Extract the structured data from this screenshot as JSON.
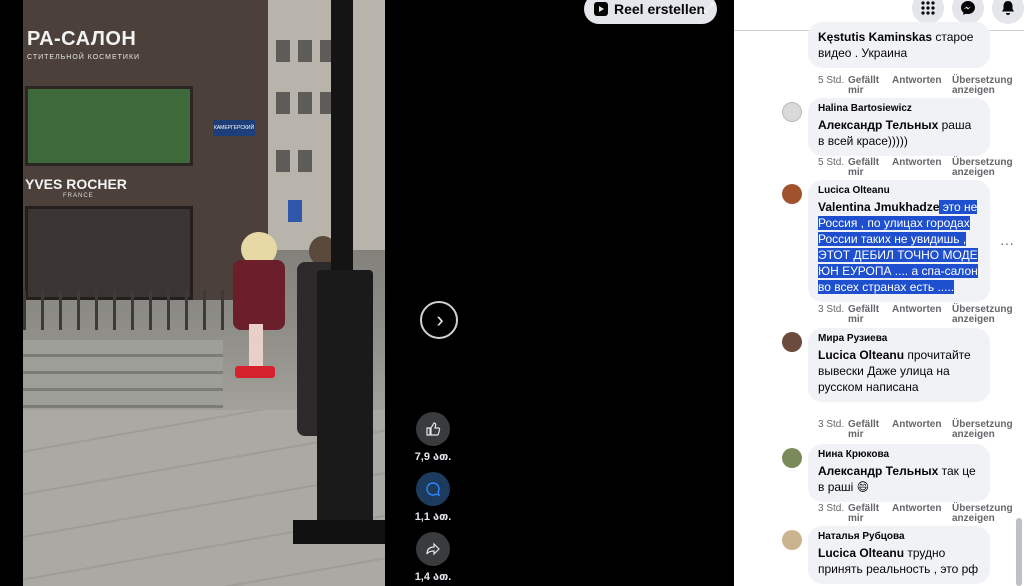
{
  "viewer": {
    "reel_button_label": "Reel erstellen",
    "scene_text": {
      "shop_sign": "РА-САЛОН",
      "shop_sub": "СТИТЕЛЬНОЙ КОСМЕТИКИ",
      "brand_sign": "YVES ROCHER",
      "brand_sub": "FRANCE",
      "street_sign": "КАМЕРГЕРСКИЙ"
    },
    "actions": [
      {
        "name": "like",
        "icon": "thumbs-up-icon",
        "count": "7,9 ათ."
      },
      {
        "name": "comment",
        "icon": "comment-icon",
        "count": "1,1 ათ."
      },
      {
        "name": "share",
        "icon": "share-icon",
        "count": "1,4 ათ."
      }
    ]
  },
  "panel": {
    "top_icons": [
      "grid-menu-icon",
      "messenger-icon",
      "bell-icon"
    ],
    "comments": [
      {
        "author": "",
        "mention": "Kęstutis Kaminskas",
        "text": " старое видео . Украина",
        "meta": {
          "time": "5 Std.",
          "like": "Gefällt mir",
          "reply": "Antworten",
          "translate": "Übersetzung anzeigen"
        }
      },
      {
        "author": "Halina Bartosiewicz",
        "mention": "Александр Тельных",
        "text": " раша в всей красе)))))",
        "meta": {
          "time": "5 Std.",
          "like": "Gefällt mir",
          "reply": "Antworten",
          "translate": "Übersetzung anzeigen"
        }
      },
      {
        "author": "Lucica Olteanu",
        "mention": "Valentina Jmukhadze",
        "text": " это не Россия , по улицах городах России таких не увидишь , ЭТОТ ДЕБИЛ ТОЧНО МОДЕ ЮН ЕУРОПА .... а спа-салон во всех странах есть .....",
        "meta": {
          "time": "3 Std.",
          "like": "Gefällt mir",
          "reply": "Antworten",
          "translate": "Übersetzung anzeigen"
        }
      },
      {
        "author": "Мира Рузиева",
        "mention": "Lucica Olteanu",
        "text": " прочитайте вывески Даже улица на русском написана",
        "meta": {
          "time": "3 Std.",
          "like": "Gefällt mir",
          "reply": "Antworten",
          "translate": "Übersetzung anzeigen"
        }
      },
      {
        "author": "Нина Крюкова",
        "mention": "Александр Тельных",
        "text": " так це в раші 😄",
        "meta": {
          "time": "3 Std.",
          "like": "Gefällt mir",
          "reply": "Antworten",
          "translate": "Übersetzung anzeigen"
        }
      },
      {
        "author": "Наталья Рубцова",
        "mention": "Lucica Olteanu",
        "text": " трудно принять реальность , это рф",
        "meta": {}
      }
    ],
    "more_options": "···"
  },
  "colors": {
    "panel_bg": "#ffffff",
    "bubble_bg": "#f0f2f5",
    "highlight": "#1e4fcf",
    "meta_text": "#65676b"
  }
}
